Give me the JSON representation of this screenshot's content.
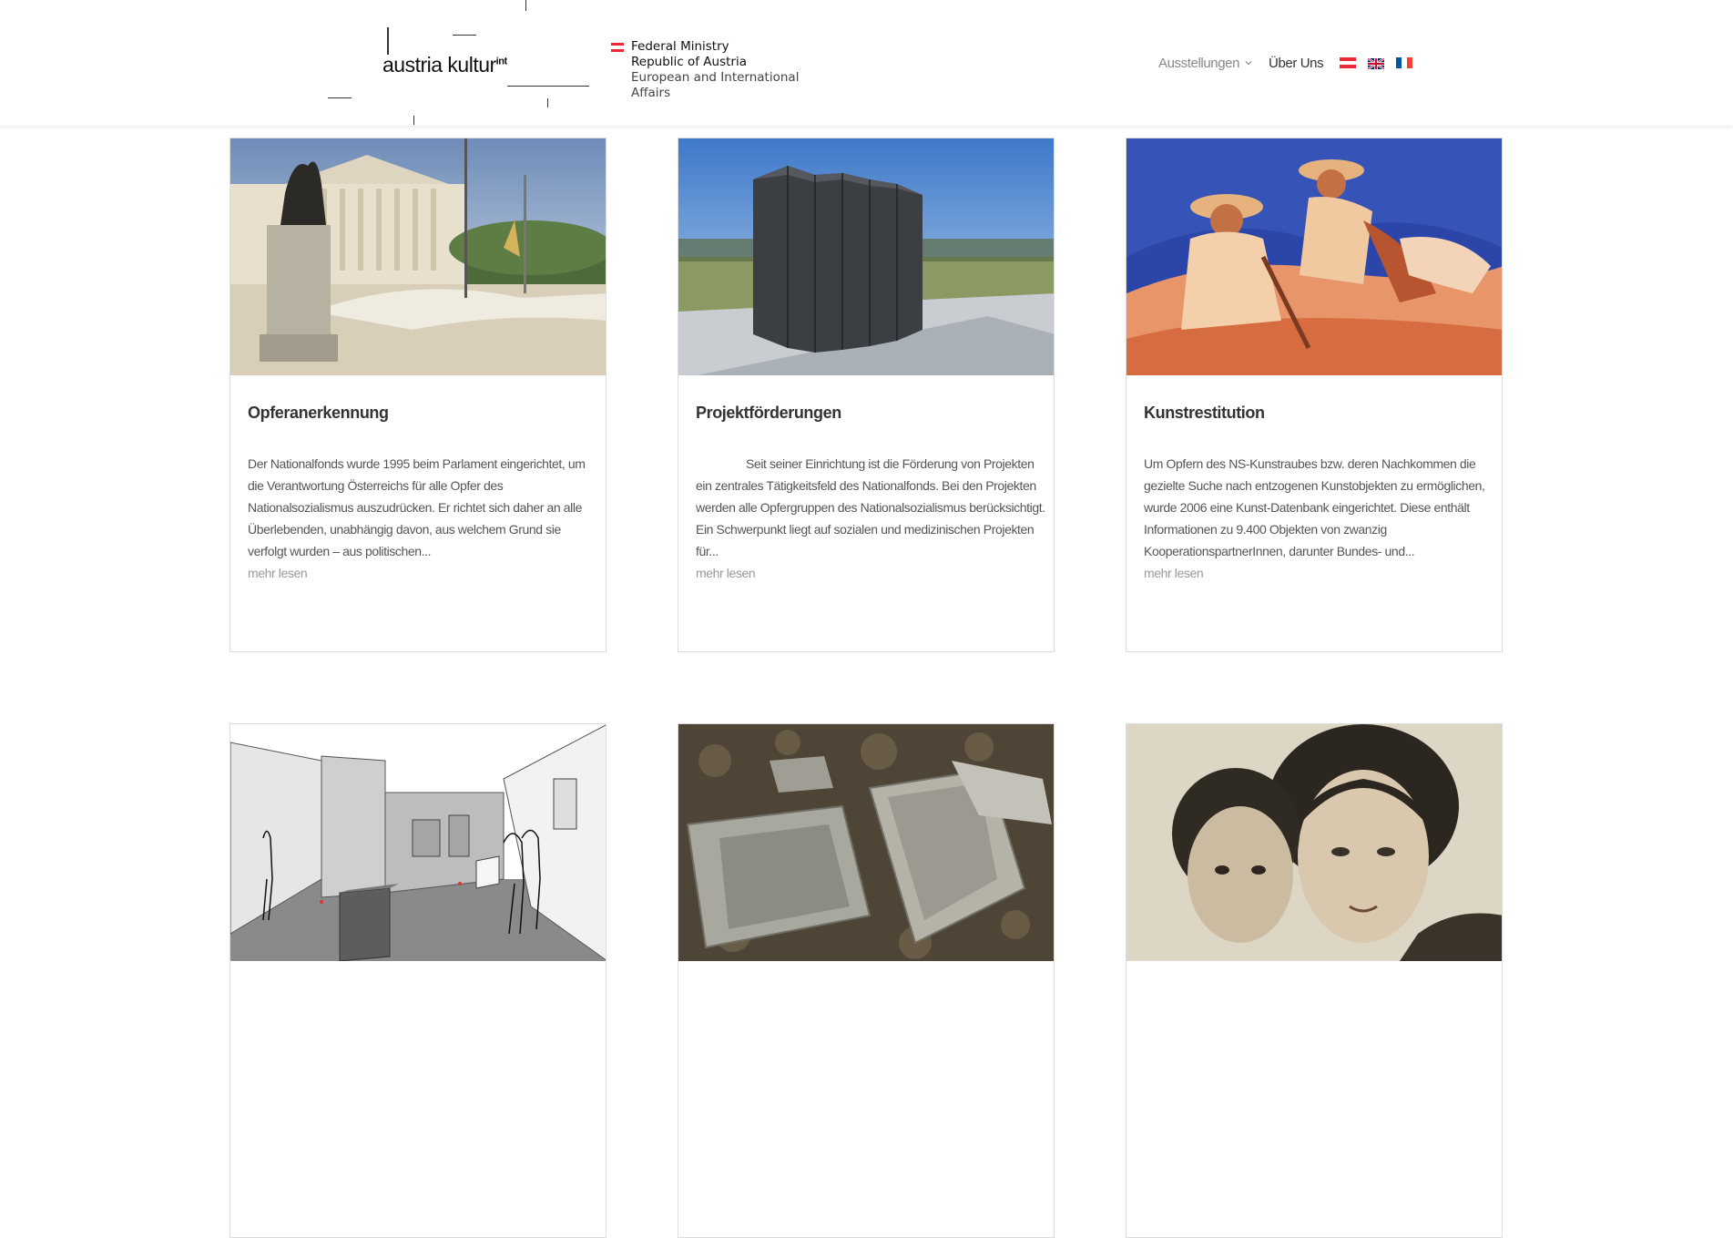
{
  "header": {
    "logo": {
      "text": "austria kultur",
      "superscript": "int"
    },
    "ministry": {
      "line1": "Federal Ministry",
      "line2": "Republic of Austria",
      "line3": "European and International",
      "line4": "Affairs"
    },
    "nav": {
      "exhibitions": "Ausstellungen",
      "about": "Über Uns",
      "languages": [
        {
          "name": "Deutsch",
          "icon": "austria-flag-icon"
        },
        {
          "name": "English",
          "icon": "uk-flag-icon"
        },
        {
          "name": "Français",
          "icon": "france-flag-icon"
        }
      ]
    }
  },
  "colors": {
    "austria_red": "#ed2939",
    "france_blue": "#0055a4",
    "uk_blue": "#012169",
    "text_dark": "#333333",
    "text_muted": "#999999"
  },
  "cards": [
    {
      "title": "Opferanerkennung",
      "excerpt": "Der Nationalfonds wurde 1995 beim Parlament eingerichtet, um die Verantwortung Österreichs für alle Opfer des Nationalsozialismus auszudrücken. Er richtet sich daher an alle Überlebenden, unabhängig davon, aus welchem Grund sie verfolgt wurden – aus politischen...",
      "more": "mehr lesen",
      "image": "parliament-photo"
    },
    {
      "title": "Projektförderungen",
      "excerpt": "Seit seiner Einrichtung ist die Förderung von Projekten ein zentrales Tätigkeitsfeld des Nationalfonds. Bei den Projekten werden alle Opfergruppen des Nationalsozialismus berücksichtigt. Ein Schwerpunkt liegt auf sozialen und medizinischen Projekten für...",
      "more": "mehr lesen",
      "image": "memorial-photo"
    },
    {
      "title": "Kunstrestitution",
      "excerpt": "Um Opfern des NS-Kunstraubes bzw. deren Nachkommen die gezielte Suche nach entzogenen Kunstobjekten zu ermöglichen, wurde 2006 eine Kunst-Datenbank eingerichtet. Diese enthält Informationen zu 9.400 Objekten von zwanzig KooperationspartnerInnen, darunter Bundes- und...",
      "more": "mehr lesen",
      "image": "painting-photo"
    },
    {
      "title": "",
      "excerpt": "",
      "more": "",
      "image": "exhibition-sketch"
    },
    {
      "title": "",
      "excerpt": "",
      "more": "",
      "image": "gravestones-photo"
    },
    {
      "title": "",
      "excerpt": "",
      "more": "",
      "image": "portrait-photo"
    }
  ]
}
